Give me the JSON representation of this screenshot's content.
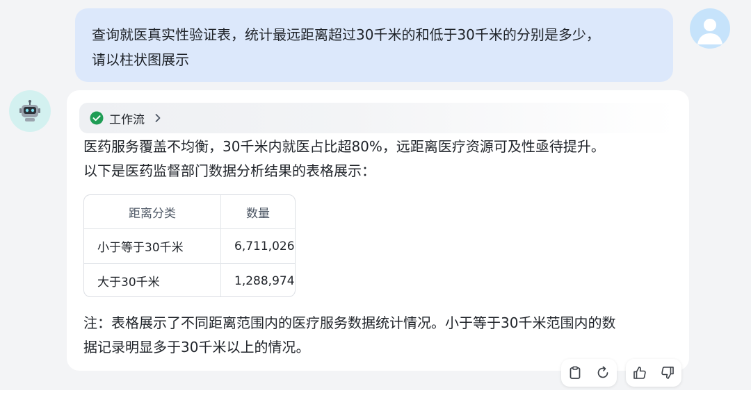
{
  "user_message": {
    "line1": "查询就医真实性验证表，统计最远距离超过30千米的和低于30千米的分别是多少，",
    "line2": "请以柱状图展示"
  },
  "assistant": {
    "workflow_label": "工作流",
    "intro_line1": "医药服务覆盖不均衡，30千米内就医占比超80%，远距离医疗资源可及性亟待提升。",
    "intro_line2": "以下是医药监督部门数据分析结果的表格展示：",
    "table": {
      "headers": [
        "距离分类",
        "数量"
      ],
      "rows": [
        [
          "小于等于30千米",
          "6,711,026"
        ],
        [
          "大于30千米",
          "1,288,974"
        ]
      ]
    },
    "note_line1": "注：表格展示了不同距离范围内的医疗服务数据统计情况。小于等于30千米范围内的数",
    "note_line2": "据记录明显多于30千米以上的情况。"
  },
  "icons": {
    "workflow_status": "check-circle-icon",
    "workflow_expand": "chevron-right-icon",
    "copy": "clipboard-icon",
    "regenerate": "refresh-icon",
    "like": "thumbs-up-icon",
    "dislike": "thumbs-down-icon"
  },
  "colors": {
    "user_bubble": "#dce8fb",
    "check_green": "#1f9d55",
    "bot_avatar_bg": "#d3f1f0",
    "user_avatar_bg": "#c6e3fb"
  }
}
